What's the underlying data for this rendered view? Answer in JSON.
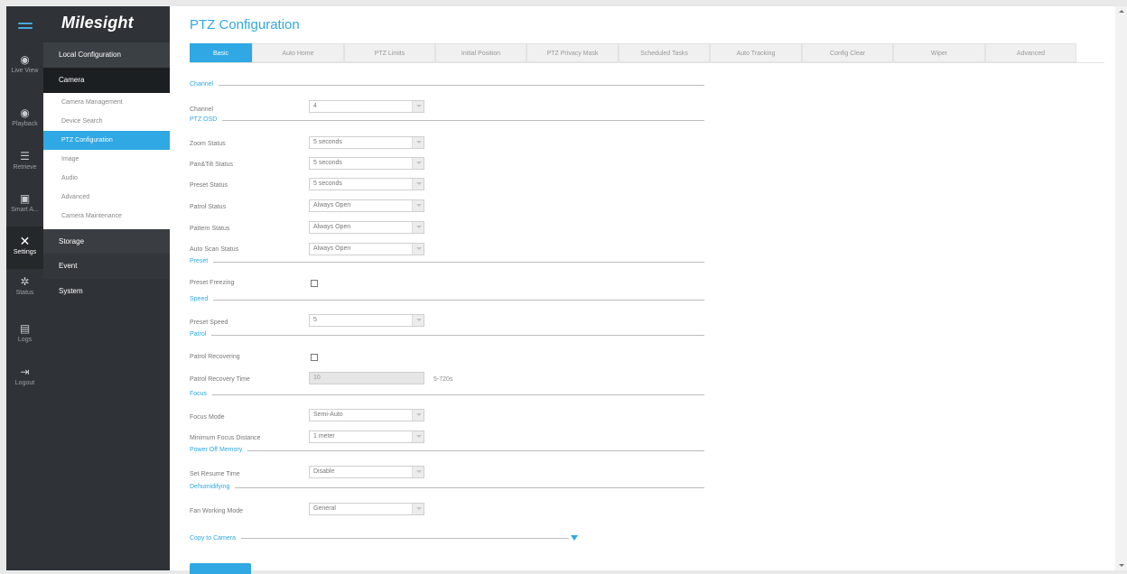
{
  "app": {
    "logo": "Milesight"
  },
  "iconbar": {
    "items": [
      {
        "label": "Live View",
        "icon": "live-view-icon"
      },
      {
        "label": "Playback",
        "icon": "playback-icon"
      },
      {
        "label": "Retrieve",
        "icon": "retrieve-icon"
      },
      {
        "label": "Smart A...",
        "icon": "smart-analysis-icon"
      },
      {
        "label": "Settings",
        "icon": "settings-icon"
      },
      {
        "label": "Status",
        "icon": "status-icon"
      },
      {
        "label": "Logs",
        "icon": "logs-icon"
      },
      {
        "label": "Logout",
        "icon": "logout-icon"
      }
    ]
  },
  "menu": {
    "local": "Local Configuration",
    "camera": "Camera",
    "sub": [
      "Camera Management",
      "Device Search",
      "PTZ Configuration",
      "Image",
      "Audio",
      "Advanced",
      "Camera Maintenance"
    ],
    "storage": "Storage",
    "event": "Event",
    "system": "System"
  },
  "page": {
    "title": "PTZ Configuration",
    "tabs": [
      "Basic",
      "Auto Home",
      "PTZ Limits",
      "Initial Position",
      "PTZ Privacy Mask",
      "Scheduled Tasks",
      "Auto Tracking",
      "Config Clear",
      "Wiper",
      "Advanced"
    ]
  },
  "form": {
    "sections": {
      "channel": "Channel",
      "ptz_osd": "PTZ OSD",
      "preset": "Preset",
      "speed": "Speed",
      "patrol": "Patrol",
      "focus": "Focus",
      "power_off": "Power Off Memory",
      "dehumidifying": "Dehumidifying"
    },
    "channel": {
      "label": "Channel",
      "value": "4"
    },
    "zoom_status": {
      "label": "Zoom Status",
      "value": "5 seconds"
    },
    "pantilt_status": {
      "label": "Pan&Tilt Status",
      "value": "5 seconds"
    },
    "preset_status": {
      "label": "Preset Status",
      "value": "5 seconds"
    },
    "patrol_status": {
      "label": "Patrol Status",
      "value": "Always Open"
    },
    "pattern_status": {
      "label": "Pattern Status",
      "value": "Always Open"
    },
    "autoscan_status": {
      "label": "Auto Scan Status",
      "value": "Always Open"
    },
    "preset_freezing": {
      "label": "Preset Freezing",
      "checked": false
    },
    "preset_speed": {
      "label": "Preset Speed",
      "value": "5"
    },
    "patrol_recovering": {
      "label": "Patrol Recovering",
      "checked": false
    },
    "patrol_recovery_time": {
      "label": "Patrol Recovery Time",
      "value": "10",
      "hint": "5-720s"
    },
    "focus_mode": {
      "label": "Focus Mode",
      "value": "Semi-Auto"
    },
    "min_focus": {
      "label": "Minimum Focus Distance",
      "value": "1 meter"
    },
    "resume_time": {
      "label": "Set Resume Time",
      "value": "Disable"
    },
    "fan_mode": {
      "label": "Fan Working Mode",
      "value": "General"
    },
    "copy_to_camera": "Copy to Camera"
  }
}
